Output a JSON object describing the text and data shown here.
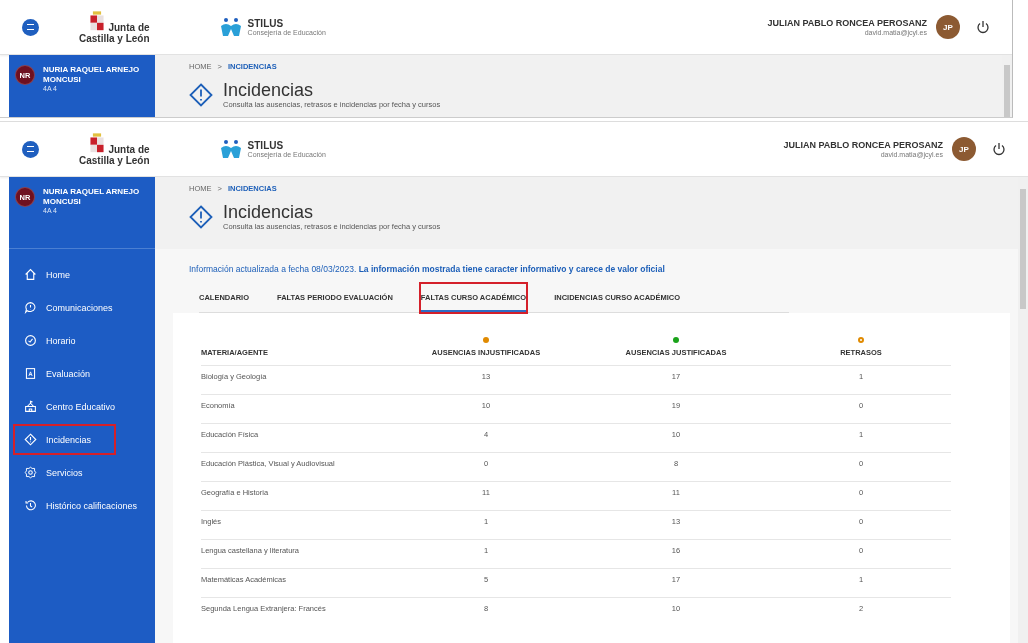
{
  "background_window": {
    "header": {
      "org_line1": "Junta de",
      "org_line2": "Castilla y León",
      "app_name": "STILUS",
      "app_subtitle": "Consejería de Educación",
      "user_name": "JULIAN PABLO RONCEA PEROSANZ",
      "user_email": "david.matia@jcyl.es",
      "user_initials": "JP"
    },
    "student": {
      "initials": "NR",
      "name": "NURIA RAQUEL ARNEJO MONCUSI",
      "group": "4A 4"
    },
    "breadcrumb": [
      {
        "label": "HOME",
        "current": false
      },
      {
        "label": ">",
        "current": false
      },
      {
        "label": "INCIDENCIAS",
        "current": true
      }
    ],
    "page": {
      "title": "Incidencias",
      "subtitle": "Consulta las ausencias, retrasos e incidencias por fecha y cursos"
    }
  },
  "window": {
    "header": {
      "org_line1": "Junta de",
      "org_line2": "Castilla y León",
      "app_name": "STILUS",
      "app_subtitle": "Consejería de Educación",
      "user_name": "JULIAN PABLO RONCEA PEROSANZ",
      "user_email": "david.matia@jcyl.es",
      "user_initials": "JP"
    },
    "student": {
      "initials": "NR",
      "name": "NURIA RAQUEL ARNEJO MONCUSI",
      "group": "4A 4"
    },
    "breadcrumb": [
      {
        "label": "HOME",
        "current": false
      },
      {
        "label": ">",
        "current": false
      },
      {
        "label": "INCIDENCIAS",
        "current": true
      }
    ],
    "page": {
      "title": "Incidencias",
      "subtitle": "Consulta las ausencias, retrasos e incidencias por fecha y cursos"
    },
    "nav": [
      {
        "label": "Home",
        "highlighted": false
      },
      {
        "label": "Comunicaciones",
        "highlighted": false
      },
      {
        "label": "Horario",
        "highlighted": false
      },
      {
        "label": "Evaluación",
        "highlighted": false
      },
      {
        "label": "Centro Educativo",
        "highlighted": false
      },
      {
        "label": "Incidencias",
        "highlighted": true
      },
      {
        "label": "Servicios",
        "highlighted": false
      },
      {
        "label": "Histórico calificaciones",
        "highlighted": false
      }
    ],
    "notice": "Información actualizada a fecha 08/03/2023. **La información mostrada tiene caracter informativo y carece de valor oficial**",
    "tabs": [
      {
        "label": "CALENDARIO",
        "selected": false,
        "highlighted": false
      },
      {
        "label": "FALTAS PERIODO EVALUACIÓN",
        "selected": false,
        "highlighted": false
      },
      {
        "label": "FALTAS CURSO ACADÉMICO",
        "selected": true,
        "highlighted": true
      },
      {
        "label": "INCIDENCIAS CURSO ACADÉMICO",
        "selected": false,
        "highlighted": false
      }
    ],
    "table": {
      "columns": [
        {
          "label": "MATERIA/AGENTE"
        },
        {
          "label": "AUSENCIAS INJUSTIFICADAS",
          "kind": "filled",
          "color": "#e08a00"
        },
        {
          "label": "AUSENCIAS JUSTIFICADAS",
          "kind": "filled",
          "color": "#1aa31a"
        },
        {
          "label": "RETRASOS",
          "kind": "ring",
          "color": "#e08a00"
        }
      ],
      "rows": [
        [
          "Biología y Geología",
          "13",
          "17",
          "1"
        ],
        [
          "Economía",
          "10",
          "19",
          "0"
        ],
        [
          "Educación Física",
          "4",
          "10",
          "1"
        ],
        [
          "Educación Plástica, Visual y Audiovisual",
          "0",
          "8",
          "0"
        ],
        [
          "Geografía e Historia",
          "11",
          "11",
          "0"
        ],
        [
          "Inglés",
          "1",
          "13",
          "0"
        ],
        [
          "Lengua castellana y literatura",
          "1",
          "16",
          "0"
        ],
        [
          "Matemáticas Académicas",
          "5",
          "17",
          "1"
        ],
        [
          "Segunda Lengua Extranjera: Francés",
          "8",
          "10",
          "2"
        ]
      ]
    }
  }
}
